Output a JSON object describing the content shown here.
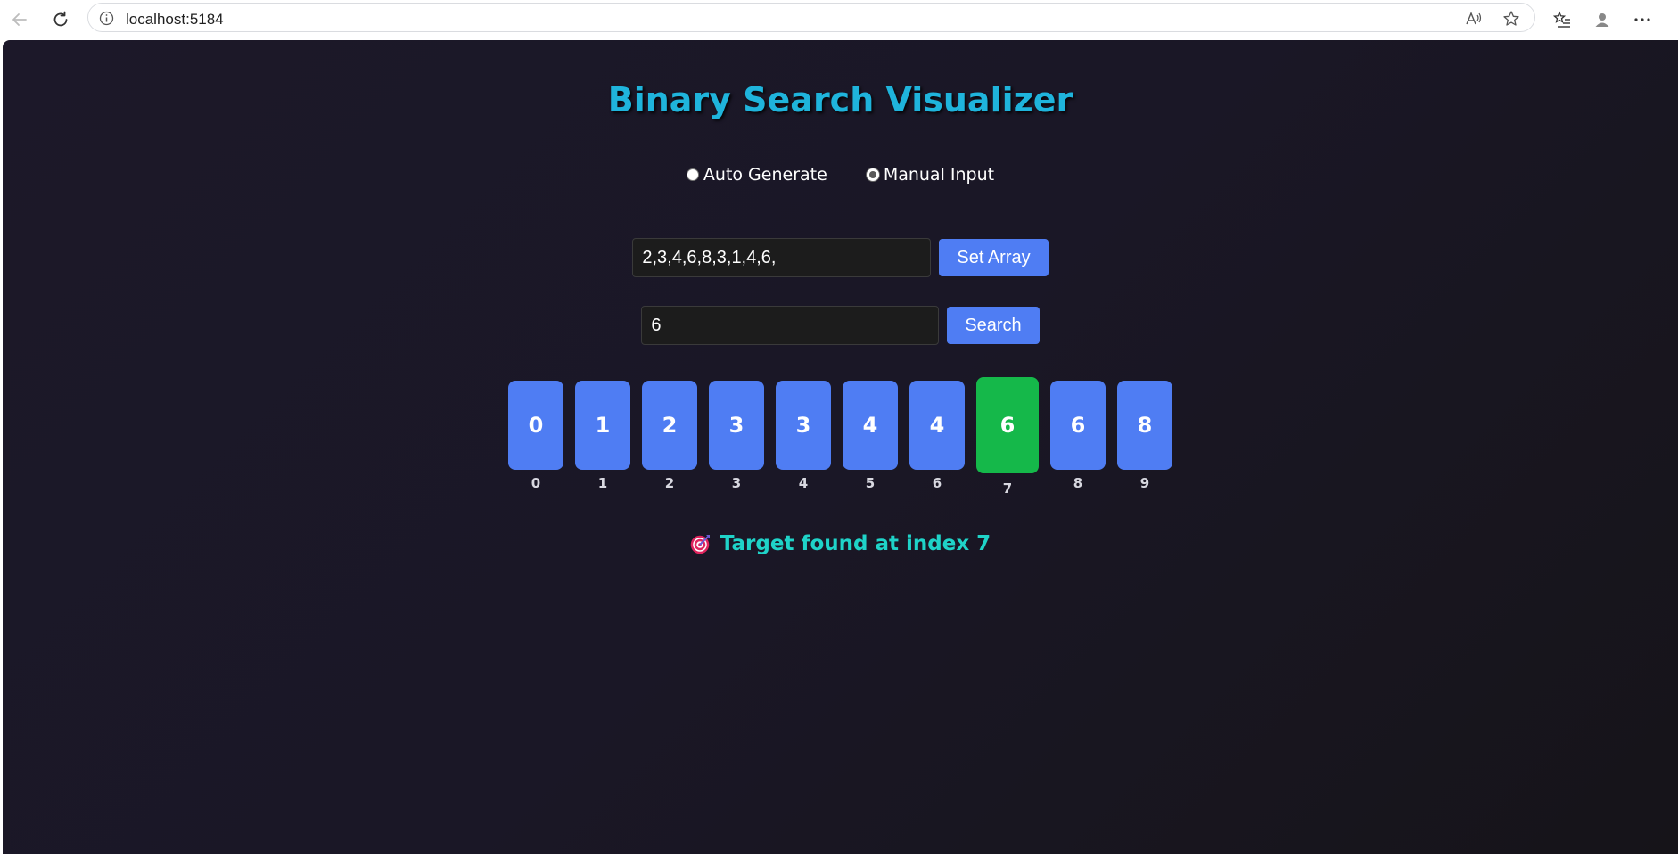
{
  "browser": {
    "url": "localhost:5184"
  },
  "app": {
    "title": "Binary Search Visualizer",
    "modes": [
      {
        "label": "Auto Generate",
        "checked": false
      },
      {
        "label": "Manual Input",
        "checked": true
      }
    ],
    "array_input": {
      "value": "2,3,4,6,8,3,1,4,6,"
    },
    "set_array_label": "Set Array",
    "target_input": {
      "value": "6"
    },
    "search_label": "Search",
    "cells": [
      {
        "value": "0",
        "index": "0",
        "found": false
      },
      {
        "value": "1",
        "index": "1",
        "found": false
      },
      {
        "value": "2",
        "index": "2",
        "found": false
      },
      {
        "value": "3",
        "index": "3",
        "found": false
      },
      {
        "value": "3",
        "index": "4",
        "found": false
      },
      {
        "value": "4",
        "index": "5",
        "found": false
      },
      {
        "value": "4",
        "index": "6",
        "found": false
      },
      {
        "value": "6",
        "index": "7",
        "found": true
      },
      {
        "value": "6",
        "index": "8",
        "found": false
      },
      {
        "value": "8",
        "index": "9",
        "found": false
      }
    ],
    "result_text": "Target found at index 7",
    "result_icon": "target-emoji-icon",
    "colors": {
      "title": "#1fb4dc",
      "cell": "#4f7df3",
      "found_cell": "#15b84a",
      "result": "#1fd3c8",
      "button": "#4f7df3"
    }
  }
}
